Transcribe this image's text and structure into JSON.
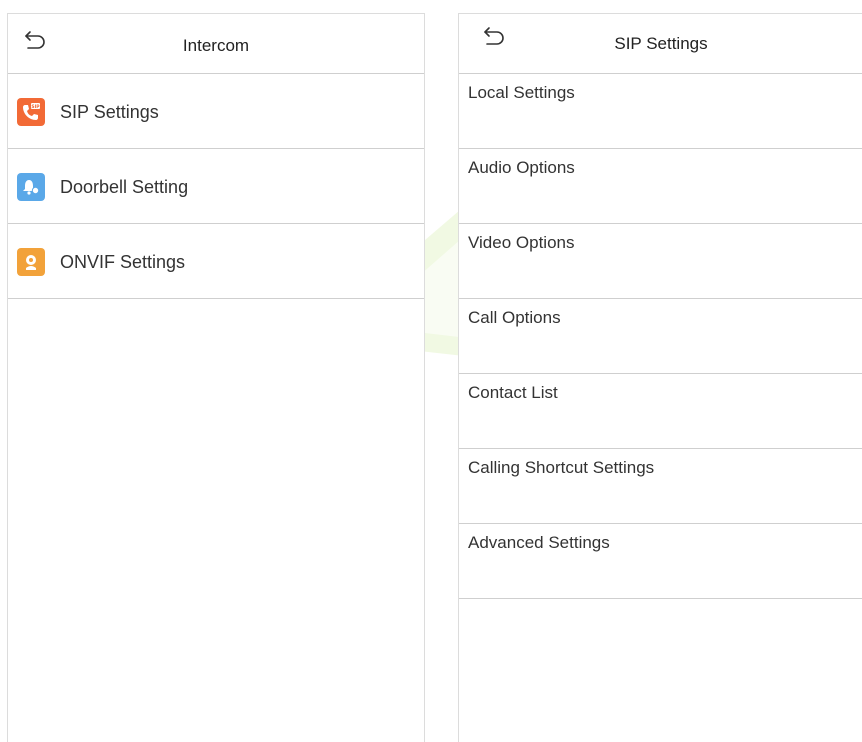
{
  "left_screen": {
    "header": {
      "title": "Intercom",
      "back_icon": "back-arrow-icon"
    },
    "items": [
      {
        "label": "SIP Settings",
        "icon": "sip-phone-icon",
        "icon_color": "#f26a36"
      },
      {
        "label": "Doorbell Setting",
        "icon": "doorbell-icon",
        "icon_color": "#5aa8e8"
      },
      {
        "label": "ONVIF Settings",
        "icon": "onvif-camera-icon",
        "icon_color": "#f2a23a"
      }
    ]
  },
  "right_screen": {
    "header": {
      "title": "SIP Settings",
      "back_icon": "back-arrow-icon"
    },
    "items": [
      {
        "label": "Local Settings"
      },
      {
        "label": "Audio Options"
      },
      {
        "label": "Video Options"
      },
      {
        "label": "Call Options"
      },
      {
        "label": "Contact List"
      },
      {
        "label": "Calling Shortcut Settings"
      },
      {
        "label": "Advanced Settings"
      }
    ]
  },
  "colors": {
    "divider": "#cfcfcf",
    "text": "#333333",
    "background": "#ffffff"
  }
}
